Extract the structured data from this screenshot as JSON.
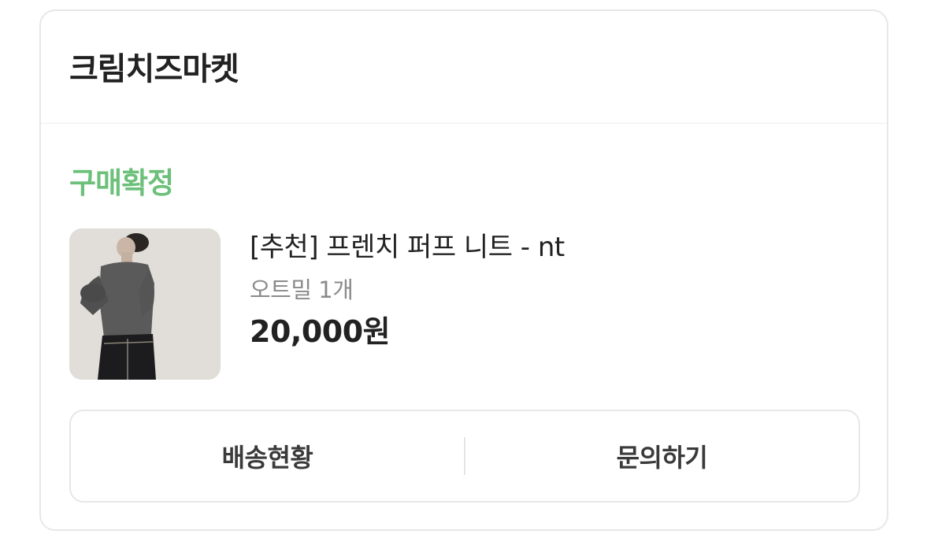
{
  "store": {
    "name": "크림치즈마켓"
  },
  "order": {
    "status": "구매확정",
    "status_color": "#6cc07a",
    "product": {
      "name": "[추천] 프렌치 퍼프 니트 - nt",
      "option": "오트밀 1개",
      "price": "20,000원"
    }
  },
  "actions": {
    "shipping_label": "배송현황",
    "inquiry_label": "문의하기"
  }
}
